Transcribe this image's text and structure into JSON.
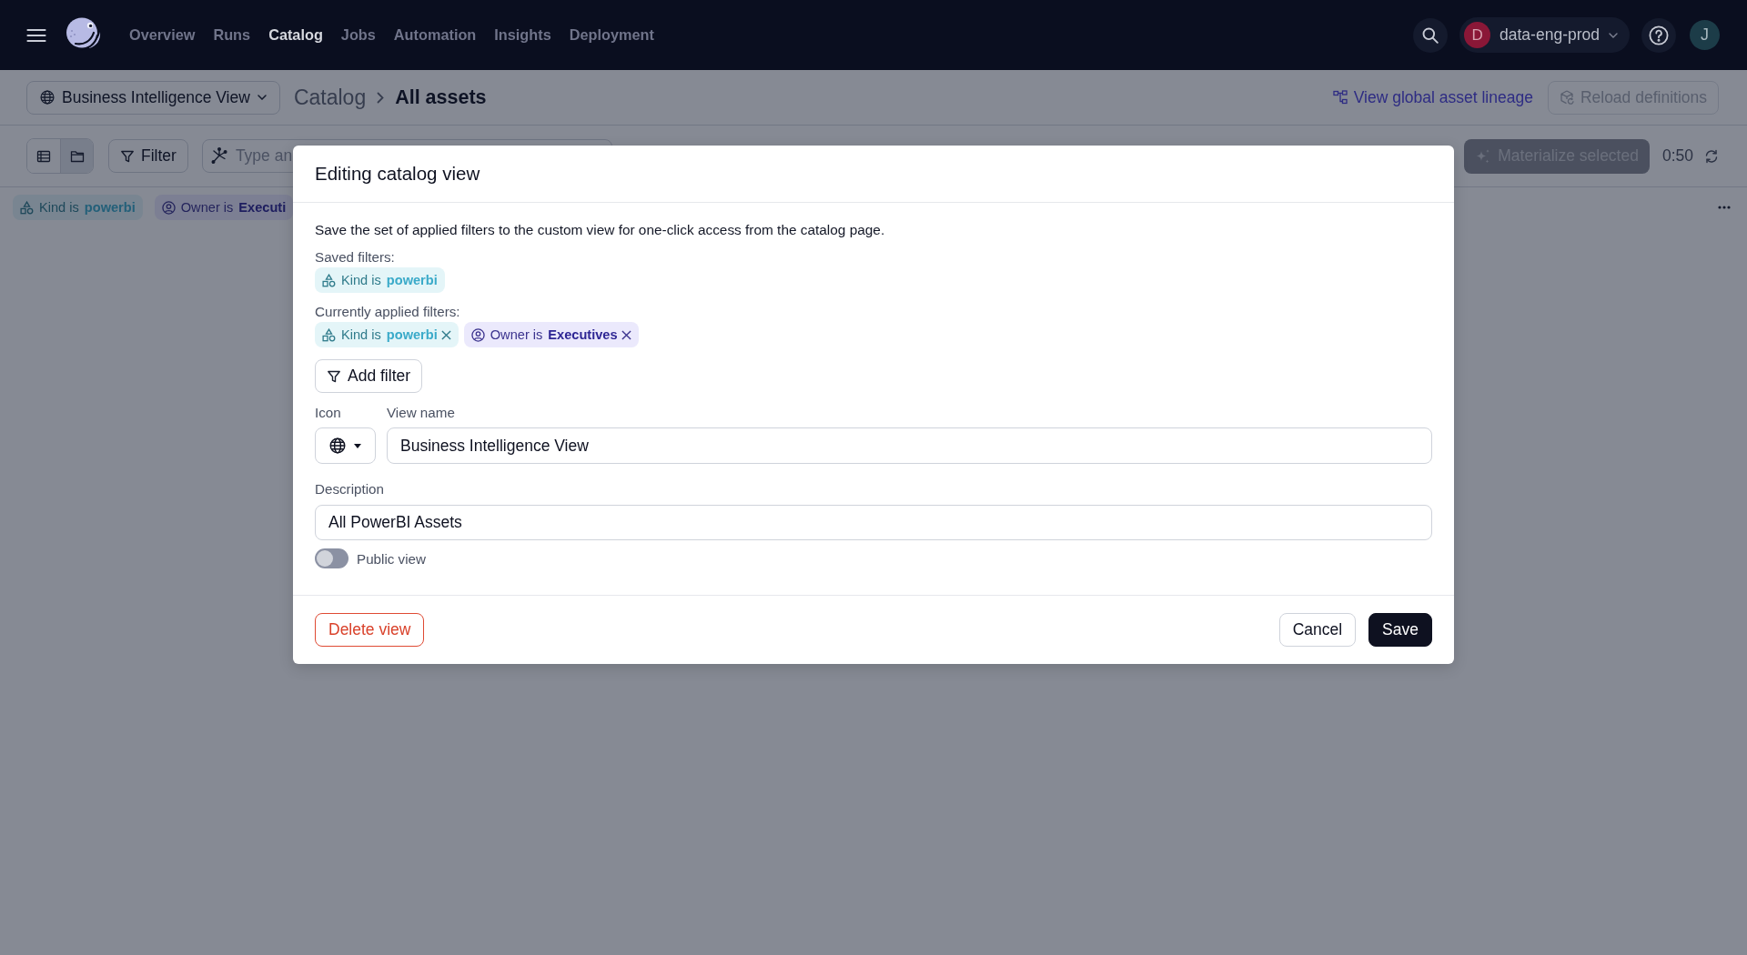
{
  "top_nav": {
    "items": [
      {
        "label": "Overview",
        "selected": false
      },
      {
        "label": "Runs",
        "selected": false
      },
      {
        "label": "Catalog",
        "selected": true
      },
      {
        "label": "Jobs",
        "selected": false
      },
      {
        "label": "Automation",
        "selected": false
      },
      {
        "label": "Insights",
        "selected": false
      },
      {
        "label": "Deployment",
        "selected": false
      }
    ],
    "workspace": {
      "initial": "D",
      "name": "data-eng-prod"
    },
    "user_initial": "J"
  },
  "header": {
    "view_selector": "Business Intelligence View",
    "breadcrumb": [
      "Catalog",
      "All assets"
    ],
    "lineage_link": "View global asset lineage",
    "reload_button": {
      "label": "Reload definitions",
      "disabled": true
    }
  },
  "toolbar": {
    "view_modes": [
      {
        "kind": "list",
        "selected": false
      },
      {
        "kind": "folder",
        "selected": true
      }
    ],
    "filter_button": "Filter",
    "search": {
      "placeholder": "Type an"
    },
    "materialize_button": {
      "label": "Materialize selected",
      "disabled": true
    },
    "refresh_timer": "0:50"
  },
  "active_filters": [
    {
      "kind": "kind",
      "label": "Kind is",
      "value": "powerbi"
    },
    {
      "kind": "owner",
      "label": "Owner is",
      "value": "Executi"
    }
  ],
  "dialog": {
    "title": "Editing catalog view",
    "description": "Save the set of applied filters to the custom view for one-click access from the catalog page.",
    "saved_filters": {
      "label": "Saved filters:",
      "tags": [
        {
          "kind": "kind",
          "label": "Kind is",
          "value": "powerbi",
          "removable": false
        }
      ]
    },
    "applied_filters": {
      "label": "Currently applied filters:",
      "tags": [
        {
          "kind": "kind",
          "label": "Kind is",
          "value": "powerbi",
          "removable": true
        },
        {
          "kind": "owner",
          "label": "Owner is",
          "value": "Executives",
          "removable": true
        }
      ]
    },
    "add_filter_button": "Add filter",
    "icon_field": {
      "label": "Icon"
    },
    "name_field": {
      "label": "View name",
      "value": "Business Intelligence View"
    },
    "description_field": {
      "label": "Description",
      "value": "All PowerBI Assets"
    },
    "public_toggle": {
      "label": "Public view",
      "on": false
    },
    "delete_button": "Delete view",
    "cancel_button": "Cancel",
    "save_button": "Save"
  }
}
